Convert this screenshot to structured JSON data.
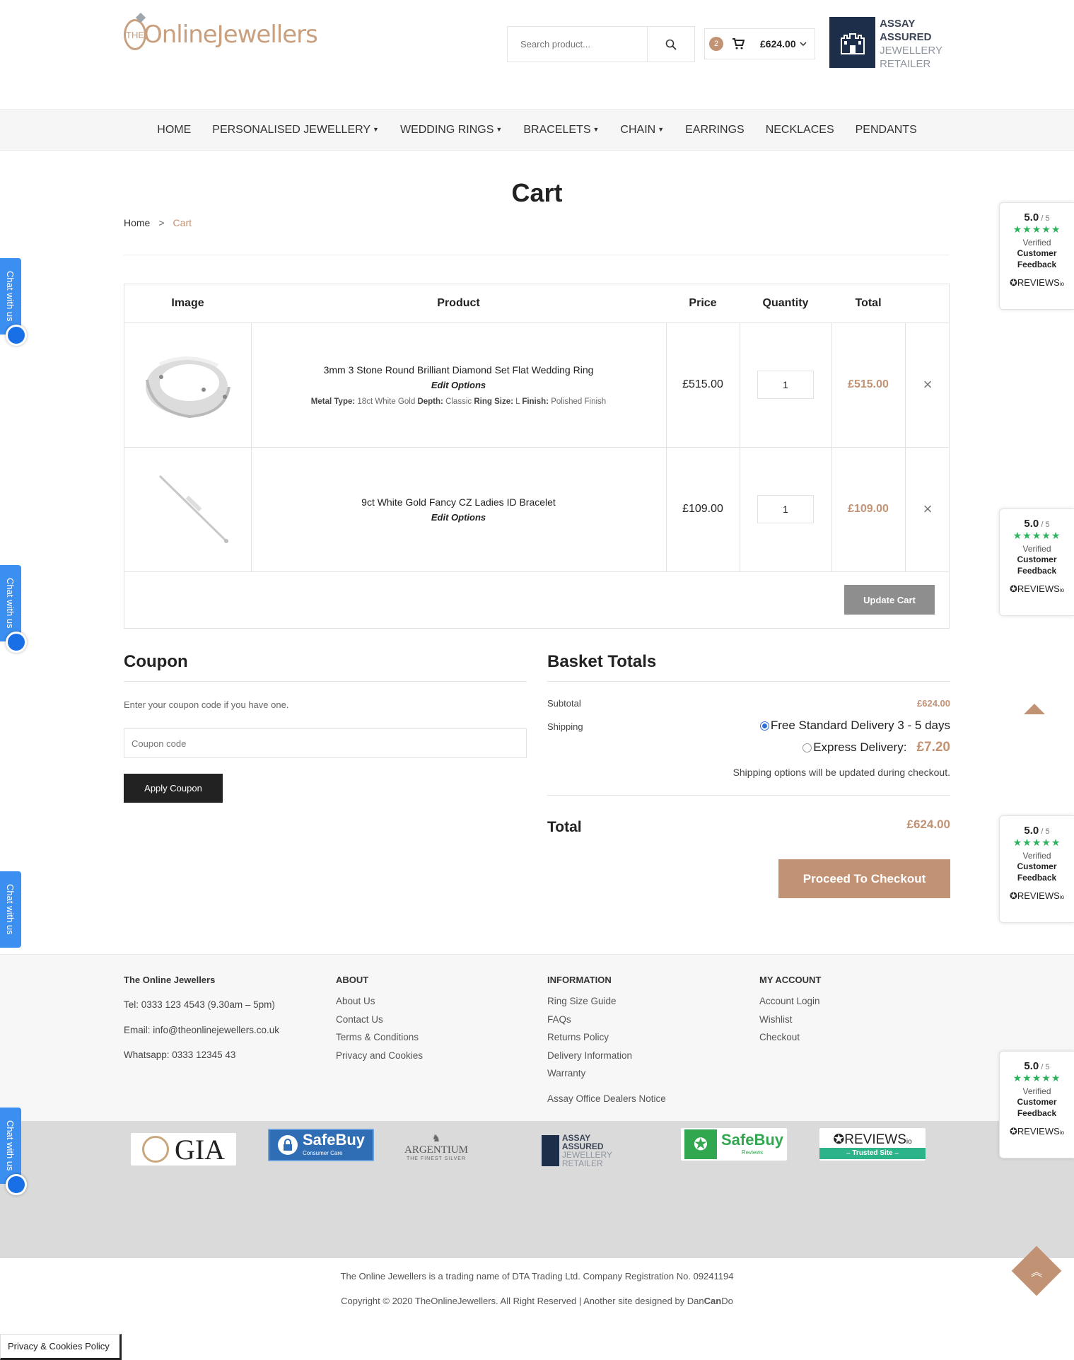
{
  "header": {
    "logo_small": "THE",
    "logo_word": "OnlineJewellers",
    "search_placeholder": "Search product...",
    "cart_count": "2",
    "cart_total": "£624.00",
    "assay_line1": "ASSAY",
    "assay_line2": "ASSURED",
    "assay_line3": "JEWELLERY",
    "assay_line4": "RETAILER"
  },
  "nav": {
    "items": [
      {
        "label": "HOME",
        "dropdown": false
      },
      {
        "label": "PERSONALISED JEWELLERY",
        "dropdown": true
      },
      {
        "label": "WEDDING RINGS",
        "dropdown": true
      },
      {
        "label": "BRACELETS",
        "dropdown": true
      },
      {
        "label": "CHAIN",
        "dropdown": true
      },
      {
        "label": "EARRINGS",
        "dropdown": false
      },
      {
        "label": "NECKLACES",
        "dropdown": false
      },
      {
        "label": "PENDANTS",
        "dropdown": false
      }
    ]
  },
  "page": {
    "title": "Cart",
    "breadcrumb_home": "Home",
    "breadcrumb_sep": ">",
    "breadcrumb_current": "Cart"
  },
  "cart_table": {
    "headers": {
      "image": "Image",
      "product": "Product",
      "price": "Price",
      "quantity": "Quantity",
      "total": "Total"
    },
    "rows": [
      {
        "name": "3mm 3 Stone Round Brilliant Diamond Set Flat Wedding Ring",
        "edit": "Edit Options",
        "meta_label1": "Metal Type:",
        "meta_val1": "18ct White Gold",
        "meta_label2": "Depth:",
        "meta_val2": "Classic",
        "meta_label3": "Ring Size:",
        "meta_val3": "L",
        "meta_label4": "Finish:",
        "meta_val4": "Polished Finish",
        "price": "£515.00",
        "qty": "1",
        "total": "£515.00"
      },
      {
        "name": "9ct White Gold Fancy CZ Ladies ID Bracelet",
        "edit": "Edit Options",
        "price": "£109.00",
        "qty": "1",
        "total": "£109.00"
      }
    ],
    "remove_glyph": "×",
    "update_label": "Update Cart"
  },
  "coupon": {
    "title": "Coupon",
    "help": "Enter your coupon code if you have one.",
    "placeholder": "Coupon code",
    "apply_label": "Apply Coupon"
  },
  "totals": {
    "title": "Basket Totals",
    "subtotal_label": "Subtotal",
    "subtotal": "£624.00",
    "shipping_label": "Shipping",
    "option1": "Free Standard Delivery 3 - 5 days",
    "option2": "Express Delivery:",
    "option2_price": "£7.20",
    "note": "Shipping options will be updated during checkout.",
    "total_label": "Total",
    "total": "£624.00",
    "checkout_label": "Proceed To Checkout"
  },
  "footer": {
    "company": {
      "title": "The Online Jewellers",
      "tel": "Tel: 0333 123 4543 (9.30am – 5pm)",
      "email": "Email: info@theonlinejewellers.co.uk",
      "whatsapp": "Whatsapp: 0333 12345 43"
    },
    "about": {
      "title": "ABOUT",
      "links": [
        "About Us",
        "Contact Us",
        "Terms & Conditions",
        "Privacy and Cookies"
      ]
    },
    "information": {
      "title": "INFORMATION",
      "links": [
        "Ring Size Guide",
        "FAQs",
        "Returns Policy",
        "Delivery Information",
        "Warranty",
        "Assay Office Dealers Notice"
      ]
    },
    "account": {
      "title": "MY ACCOUNT",
      "links": [
        "Account Login",
        "Wishlist",
        "Checkout"
      ]
    },
    "logos": {
      "gia": "GIA",
      "safebuy": "SafeBuy",
      "safebuy_sub": "Consumer Care",
      "argentium": "ARGENTIUM",
      "argentium_sub": "THE FINEST SILVER",
      "assay1": "ASSAY",
      "assay2": "ASSURED",
      "assay3": "JEWELLERY",
      "assay4": "RETAILER",
      "safebuy2": "SafeBuy",
      "safebuy2_sub": "Reviews",
      "reviews": "REVIEWS",
      "reviews_io": "io",
      "reviews_sub": "– Trusted Site –"
    },
    "trading": "The Online Jewellers is a trading name of DTA Trading Ltd.   Company Registration No. 09241194",
    "copyright": "Copyright © 2020 TheOnlineJewellers. All Right Reserved | Another site designed by ",
    "designer_a": "Dan",
    "designer_b": "Can",
    "designer_c": "Do"
  },
  "widgets": {
    "review_score": "5.0",
    "review_out_of": " / 5",
    "review_stars": "★★★★★",
    "review_verified": "Verified",
    "review_cf1": "Customer",
    "review_cf2": "Feedback",
    "review_brand": "REVIEWS",
    "review_brand_io": "io",
    "chat_label": "Chat with us",
    "cookie_label": "Privacy & Cookies Policy",
    "scroll_top_glyph": "«"
  },
  "colors": {
    "accent": "#c29274",
    "dark": "#222222",
    "update_btn": "#8e8e8e",
    "chat": "#3b8ff0",
    "reviews_green": "#2db35e"
  }
}
